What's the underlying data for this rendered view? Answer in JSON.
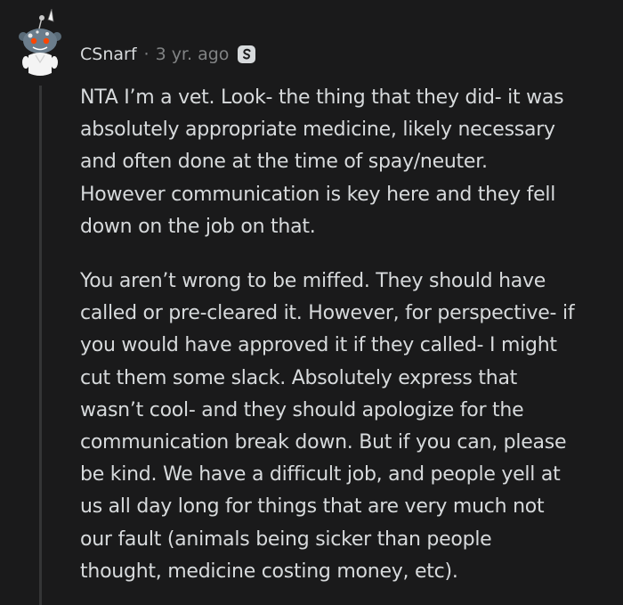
{
  "comment": {
    "author": "CSnarf",
    "separator": "·",
    "age": "3 yr. ago",
    "badge_icon": "snoo-s-award-icon",
    "paragraphs": [
      "NTA I’m a vet. Look- the thing that they did- it was\nabsolutely appropriate medicine, likely necessary\nand often done at the time of spay/neuter.\nHowever communication is key here and they fell\ndown on the job on that.",
      "You aren’t wrong to be miffed. They should have\ncalled or pre-cleared it. However, for perspective- if\nyou would have approved it if they called- I might\ncut them some slack. Absolutely express that\nwasn’t cool- and they should apologize for the\ncommunication break down. But if you can, please\nbe kind. We have a difficult job, and people yell at\nus all day long for things that are very much not\nour fault (animals being sicker than people\nthought, medicine costing money, etc)."
    ]
  },
  "colors": {
    "background": "#1a1a1b",
    "text": "#d7dadc",
    "meta": "#818384",
    "thread_line": "#343536"
  }
}
